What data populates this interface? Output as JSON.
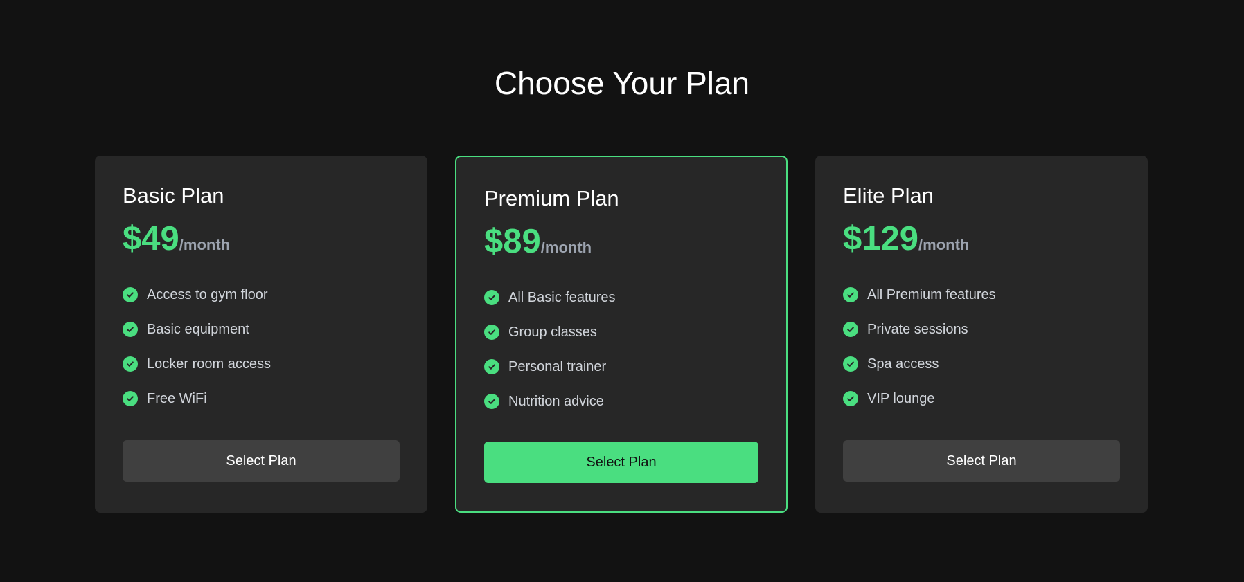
{
  "header": {
    "title": "Choose Your Plan"
  },
  "colors": {
    "background": "#121212",
    "card": "#272727",
    "accent": "#4ade80",
    "muted": "#9ca3af",
    "button": "#404040"
  },
  "plans": [
    {
      "name": "Basic Plan",
      "price": "$49",
      "period": "/month",
      "featured": false,
      "features": [
        "Access to gym floor",
        "Basic equipment",
        "Locker room access",
        "Free WiFi"
      ],
      "button_label": "Select Plan"
    },
    {
      "name": "Premium Plan",
      "price": "$89",
      "period": "/month",
      "featured": true,
      "features": [
        "All Basic features",
        "Group classes",
        "Personal trainer",
        "Nutrition advice"
      ],
      "button_label": "Select Plan"
    },
    {
      "name": "Elite Plan",
      "price": "$129",
      "period": "/month",
      "featured": false,
      "features": [
        "All Premium features",
        "Private sessions",
        "Spa access",
        "VIP lounge"
      ],
      "button_label": "Select Plan"
    }
  ],
  "icons": {
    "feature_check": "check-circle-icon"
  }
}
